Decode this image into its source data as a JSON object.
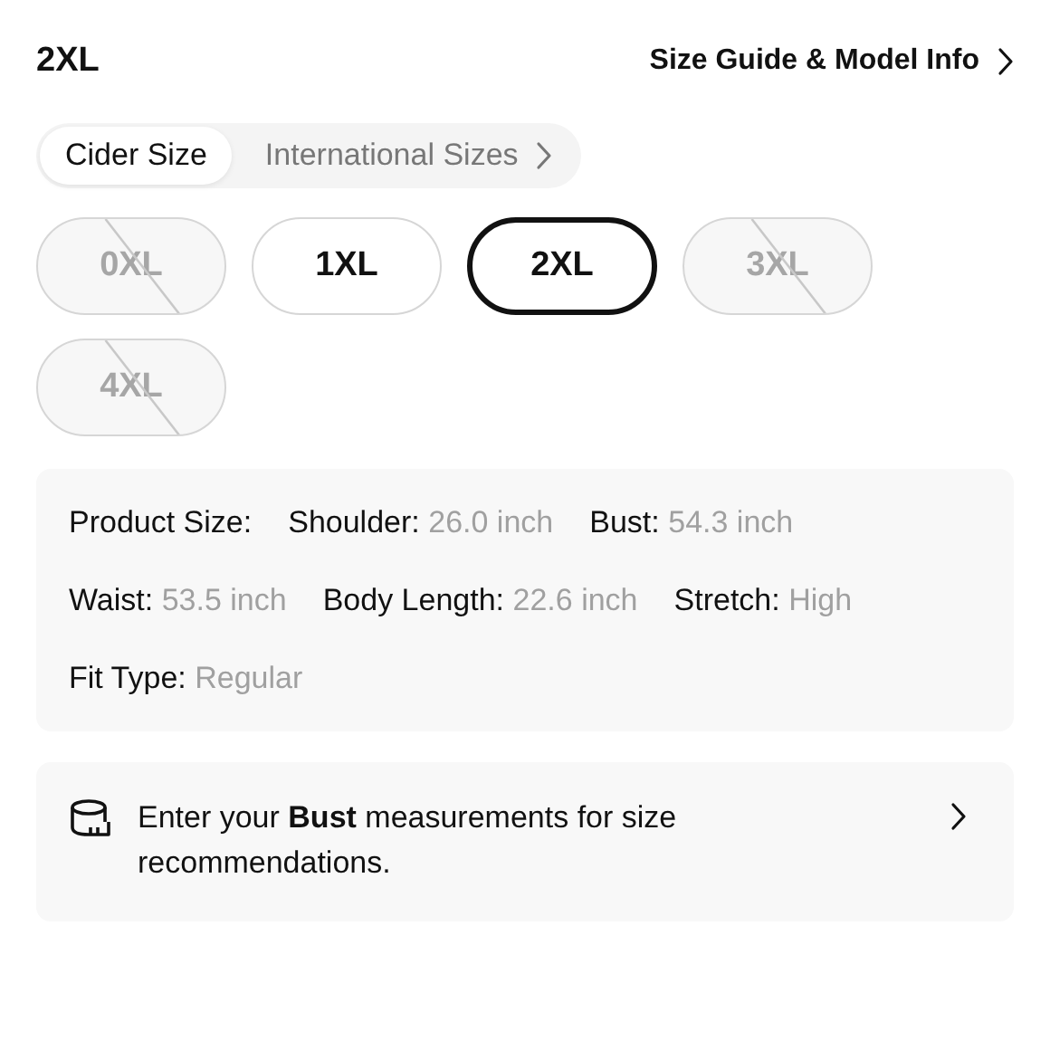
{
  "header": {
    "selected_size": "2XL",
    "guide_link": "Size Guide & Model Info"
  },
  "size_systems": [
    {
      "label": "Cider Size",
      "selected": true
    },
    {
      "label": "International Sizes",
      "selected": false
    }
  ],
  "sizes": [
    {
      "label": "0XL",
      "selected": false,
      "disabled": true
    },
    {
      "label": "1XL",
      "selected": false,
      "disabled": false
    },
    {
      "label": "2XL",
      "selected": true,
      "disabled": false
    },
    {
      "label": "3XL",
      "selected": false,
      "disabled": true
    },
    {
      "label": "4XL",
      "selected": false,
      "disabled": true
    }
  ],
  "product_size": {
    "rows": [
      [
        {
          "label": "Product Size:"
        },
        {
          "label": "Shoulder:",
          "value": "26.0 inch"
        },
        {
          "label": "Bust:",
          "value": "54.3 inch"
        }
      ],
      [
        {
          "label": "Waist:",
          "value": "53.5 inch"
        },
        {
          "label": "Body Length:",
          "value": "22.6 inch"
        },
        {
          "label": "Stretch:",
          "value": "High"
        }
      ],
      [
        {
          "label": "Fit Type:",
          "value": "Regular"
        }
      ]
    ]
  },
  "recommendation": {
    "text": "Enter your **Bust** measurements for size recommendations."
  }
}
